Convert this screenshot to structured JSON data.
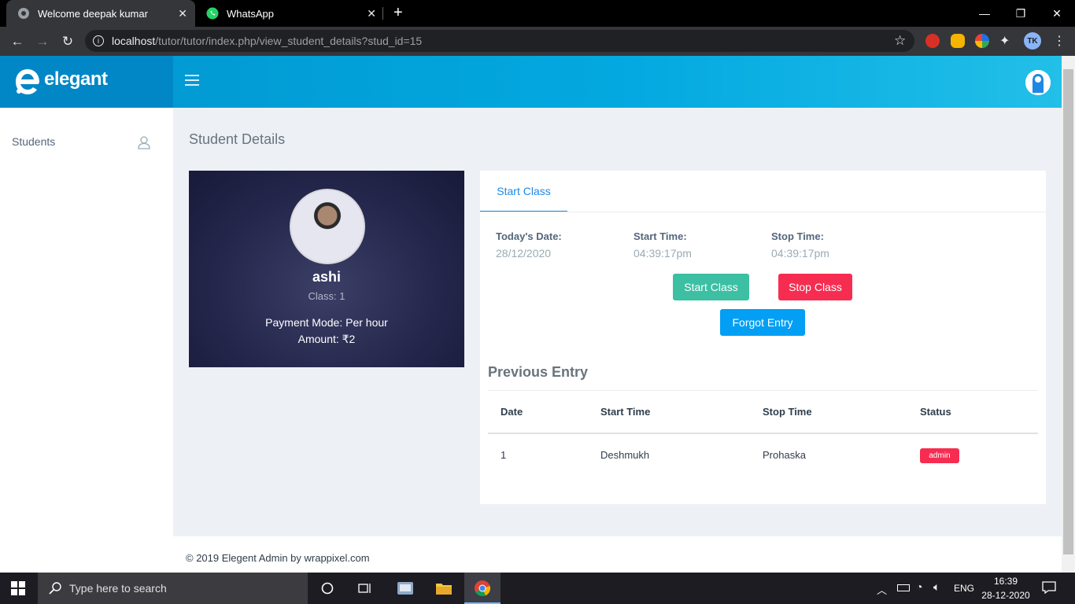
{
  "browser": {
    "tabs": [
      {
        "title": "Welcome deepak kumar",
        "active": true
      },
      {
        "title": "WhatsApp",
        "active": false
      }
    ],
    "new_tab_label": "+",
    "url_host": "localhost",
    "url_path": "/tutor/tutor/index.php/view_student_details?stud_id=15",
    "profile_initials": "TK"
  },
  "app": {
    "logo_text": "elegant",
    "sidebar": {
      "items": [
        {
          "label": "Students"
        }
      ]
    },
    "page_title": "Student Details",
    "profile": {
      "name": "ashi",
      "class": "Class: 1",
      "payment_mode": "Payment Mode: Per hour",
      "amount": "Amount: ₹2"
    },
    "class_panel": {
      "tab_label": "Start Class",
      "todays_date_label": "Today's Date:",
      "todays_date_value": "28/12/2020",
      "start_time_label": "Start Time:",
      "start_time_value": "04:39:17pm",
      "stop_time_label": "Stop Time:",
      "stop_time_value": "04:39:17pm",
      "start_button": "Start Class",
      "stop_button": "Stop Class",
      "forgot_button": "Forgot Entry"
    },
    "previous_entry": {
      "title": "Previous Entry",
      "columns": [
        "Date",
        "Start Time",
        "Stop Time",
        "Status"
      ],
      "rows": [
        {
          "date": "1",
          "start": "Deshmukh",
          "stop": "Prohaska",
          "status": "admin"
        }
      ]
    },
    "footer": "© 2019 Elegent Admin by wrappixel.com"
  },
  "taskbar": {
    "search_placeholder": "Type here to search",
    "language": "ENG",
    "time": "16:39",
    "date": "28-12-2020"
  },
  "colors": {
    "header": "#03a9e0",
    "start_button": "#3cbfa3",
    "stop_button": "#f62d51",
    "forgot_button": "#039ff4",
    "badge": "#f62d51"
  }
}
